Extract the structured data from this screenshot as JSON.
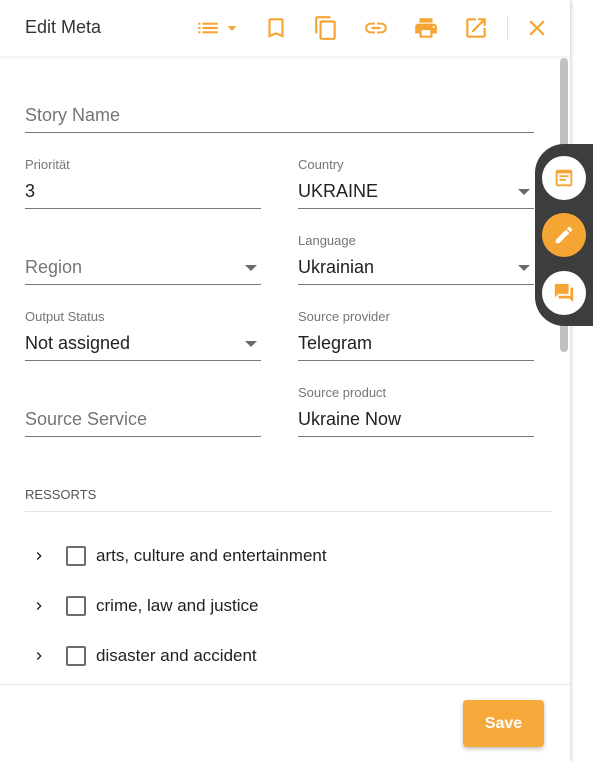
{
  "header": {
    "title": "Edit Meta",
    "icons": [
      "list-dropdown-icon",
      "bookmark-icon",
      "copy-icon",
      "link-icon",
      "print-icon",
      "open-external-icon",
      "close-icon"
    ]
  },
  "form": {
    "story_name": {
      "placeholder": "Story Name"
    },
    "priority": {
      "label": "Priorität",
      "value": "3"
    },
    "country": {
      "label": "Country",
      "value": "UKRAINE"
    },
    "region": {
      "placeholder": "Region"
    },
    "language": {
      "label": "Language",
      "value": "Ukrainian"
    },
    "output_status": {
      "label": "Output Status",
      "value": "Not assigned"
    },
    "source_provider": {
      "label": "Source provider",
      "value": "Telegram"
    },
    "source_service": {
      "placeholder": "Source Service"
    },
    "source_product": {
      "label": "Source product",
      "value": "Ukraine Now"
    }
  },
  "ressorts": {
    "title": "RESSORTS",
    "items": [
      {
        "label": "arts, culture and entertainment"
      },
      {
        "label": "crime, law and justice"
      },
      {
        "label": "disaster and accident"
      }
    ]
  },
  "footer": {
    "save_label": "Save"
  },
  "side_rail": {
    "icons": [
      "notes-icon",
      "edit-icon",
      "chat-icon"
    ]
  },
  "colors": {
    "accent": "#f5a533",
    "rail": "#3d3d3d"
  }
}
